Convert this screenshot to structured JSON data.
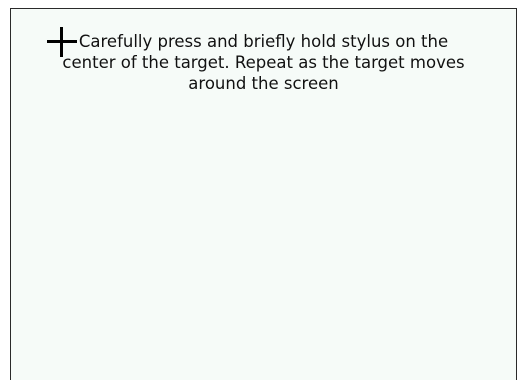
{
  "calibration": {
    "instruction_lines": [
      "Carefully press and briefly hold stylus on the",
      "center of the target. Repeat as the target moves",
      "around the screen"
    ],
    "target_icon": "crosshair-icon",
    "colors": {
      "screen_background": "#f6fbf8",
      "text": "#111111",
      "target": "#000000"
    }
  }
}
